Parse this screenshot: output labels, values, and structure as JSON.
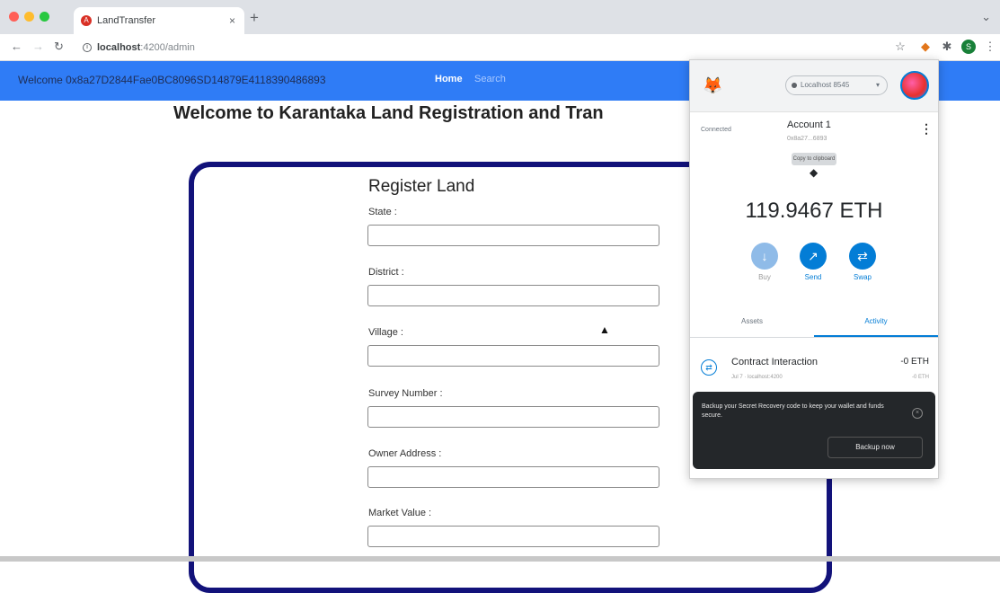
{
  "browser": {
    "tab_title": "LandTransfer",
    "tab_close": "×",
    "new_tab": "+",
    "url_host": "localhost",
    "url_path": ":4200/admin",
    "colors": {
      "tab_bar": "#dee1e6",
      "close": "#ff5f57",
      "minimize": "#febc2e",
      "maximize": "#28c840"
    },
    "icons": [
      "star-icon",
      "metamask-extension-icon",
      "puzzle-icon",
      "profile-icon",
      "menu-icon"
    ]
  },
  "app": {
    "nav": {
      "welcome": "Welcome 0x8a27D2844Fae0BC8096SD14879E4118390486893",
      "home": "Home",
      "search": "Search"
    },
    "heading": "Welcome to Karantaka Land Registration and Tran",
    "form": {
      "title": "Register Land",
      "fields": [
        {
          "label": "State :",
          "value": ""
        },
        {
          "label": "District :",
          "value": ""
        },
        {
          "label": "Village :",
          "value": ""
        },
        {
          "label": "Survey Number :",
          "value": ""
        },
        {
          "label": "Owner Address :",
          "value": ""
        },
        {
          "label": "Market Value :",
          "value": ""
        }
      ]
    },
    "colors": {
      "navbar": "#2f7cf6",
      "card_border": "#12127a"
    }
  },
  "metamask": {
    "network": "Localhost 8545",
    "connection_status": "Connected",
    "account_name": "Account 1",
    "account_address": "0x8a27...6893",
    "copy_tooltip": "Copy to clipboard",
    "balance": "119.9467 ETH",
    "actions": [
      {
        "label": "Buy",
        "icon": "download-icon",
        "enabled": false
      },
      {
        "label": "Send",
        "icon": "arrow-up-right-icon",
        "enabled": true
      },
      {
        "label": "Swap",
        "icon": "swap-icon",
        "enabled": true
      }
    ],
    "tabs": [
      {
        "label": "Assets",
        "active": false
      },
      {
        "label": "Activity",
        "active": true
      }
    ],
    "transactions": [
      {
        "title": "Contract Interaction",
        "subtitle": "Jul 7 · localhost:4200",
        "amount": "-0 ETH",
        "amount_sub": "-0 ETH"
      }
    ],
    "toast": {
      "text": "Backup your Secret Recovery code to keep your wallet and funds secure.",
      "button": "Backup now"
    },
    "colors": {
      "accent": "#037dd6",
      "toast_bg": "#24272a"
    }
  }
}
